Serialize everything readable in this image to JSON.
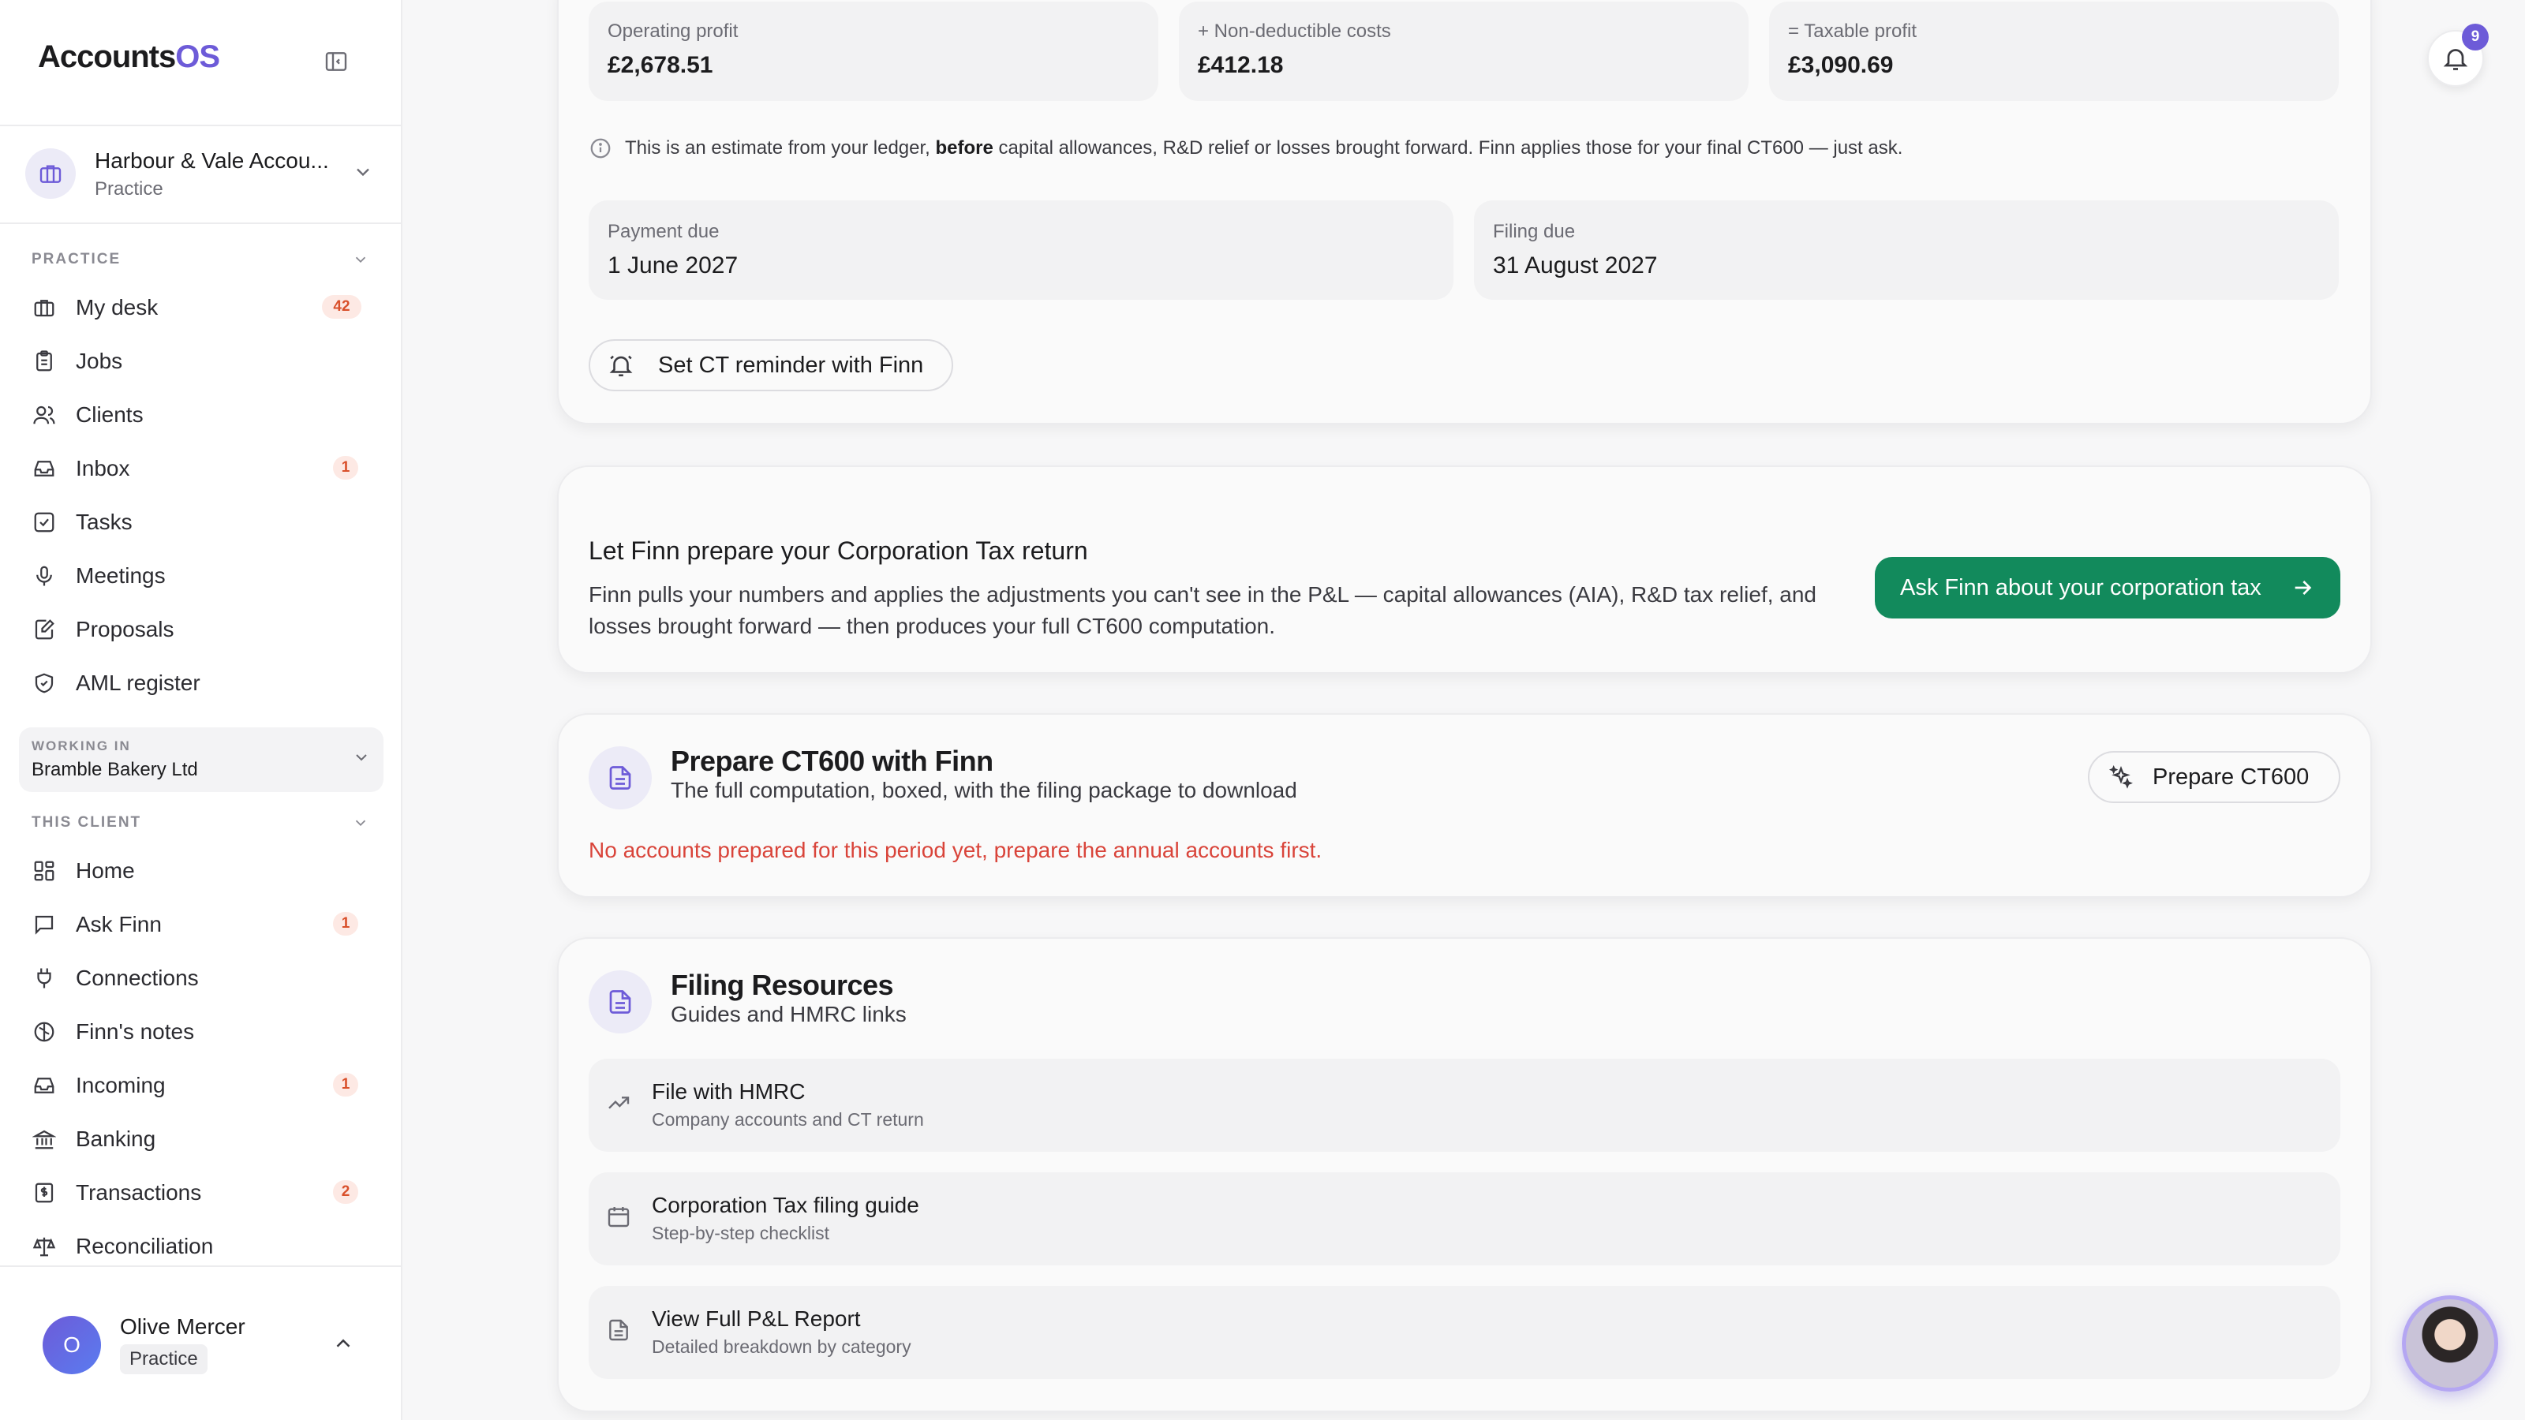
{
  "app": {
    "brand_main": "Accounts",
    "brand_accent": "OS",
    "accent_color": "#6d5bd8",
    "success_color": "#128a5c",
    "error_color": "#d9443a"
  },
  "org": {
    "name": "Harbour & Vale Accou...",
    "role": "Practice"
  },
  "sidebar": {
    "practice_label": "PRACTICE",
    "practice_items": [
      {
        "label": "My desk",
        "icon": "briefcase-icon",
        "badge": "42"
      },
      {
        "label": "Jobs",
        "icon": "clipboard-icon",
        "badge": ""
      },
      {
        "label": "Clients",
        "icon": "users-icon",
        "badge": ""
      },
      {
        "label": "Inbox",
        "icon": "inbox-icon",
        "badge": "1"
      },
      {
        "label": "Tasks",
        "icon": "checkbox-icon",
        "badge": ""
      },
      {
        "label": "Meetings",
        "icon": "microphone-icon",
        "badge": ""
      },
      {
        "label": "Proposals",
        "icon": "edit-doc-icon",
        "badge": ""
      },
      {
        "label": "AML register",
        "icon": "shield-check-icon",
        "badge": ""
      }
    ],
    "working_in_label": "WORKING IN",
    "working_in_name": "Bramble Bakery Ltd",
    "client_label": "THIS CLIENT",
    "client_items": [
      {
        "label": "Home",
        "icon": "grid-icon",
        "badge": ""
      },
      {
        "label": "Ask Finn",
        "icon": "chat-icon",
        "badge": "1"
      },
      {
        "label": "Connections",
        "icon": "plug-icon",
        "badge": ""
      },
      {
        "label": "Finn's notes",
        "icon": "brain-icon",
        "badge": ""
      },
      {
        "label": "Incoming",
        "icon": "inbox-icon",
        "badge": "1"
      },
      {
        "label": "Banking",
        "icon": "bank-icon",
        "badge": ""
      },
      {
        "label": "Transactions",
        "icon": "receipt-icon",
        "badge": "2"
      },
      {
        "label": "Reconciliation",
        "icon": "scale-icon",
        "badge": ""
      }
    ]
  },
  "user": {
    "initial": "O",
    "name": "Olive Mercer",
    "role": "Practice"
  },
  "tax_summary": {
    "operating_profit_label": "Operating profit",
    "operating_profit": "£2,678.51",
    "non_deductible_label": "+ Non-deductible costs",
    "non_deductible": "£412.18",
    "taxable_profit_label": "= Taxable profit",
    "taxable_profit": "£3,090.69",
    "note_before": "This is an estimate from your ledger, ",
    "note_bold": "before",
    "note_after": " capital allowances, R&D relief or losses brought forward. Finn applies those for your final CT600 — just ask.",
    "payment_due_label": "Payment due",
    "payment_due": "1 June 2027",
    "filing_due_label": "Filing due",
    "filing_due": "31 August 2027",
    "reminder_button": "Set CT reminder with Finn"
  },
  "finn_prepare": {
    "title": "Let Finn prepare your Corporation Tax return",
    "description": "Finn pulls your numbers and applies the adjustments you can't see in the P&L — capital allowances (AIA), R&D tax relief, and losses brought forward — then produces your full CT600 computation.",
    "cta_label": "Ask Finn about your corporation tax"
  },
  "ct600": {
    "title": "Prepare CT600 with Finn",
    "subtitle": "The full computation, boxed, with the filing package to download",
    "button": "Prepare CT600",
    "error": "No accounts prepared for this period yet, prepare the annual accounts first."
  },
  "resources": {
    "title": "Filing Resources",
    "subtitle": "Guides and HMRC links",
    "items": [
      {
        "title": "File with HMRC",
        "subtitle": "Company accounts and CT return",
        "icon": "trending-up-icon"
      },
      {
        "title": "Corporation Tax filing guide",
        "subtitle": "Step-by-step checklist",
        "icon": "calendar-icon"
      },
      {
        "title": "View Full P&L Report",
        "subtitle": "Detailed breakdown by category",
        "icon": "document-icon"
      }
    ]
  },
  "notifications": {
    "count": "9"
  }
}
